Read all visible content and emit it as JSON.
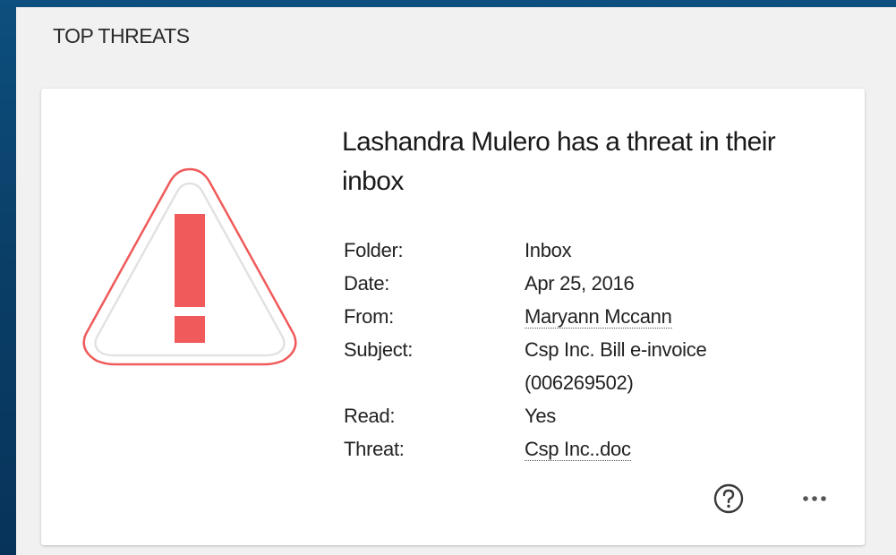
{
  "panel": {
    "title": "TOP THREATS"
  },
  "threat_card": {
    "heading": "Lashandra Mulero has a threat in their inbox",
    "icon": "warning-triangle-icon",
    "fields": [
      {
        "label": "Folder:",
        "value": "Inbox"
      },
      {
        "label": "Date:",
        "value": "Apr 25, 2016"
      },
      {
        "label": "From:",
        "value": "Maryann Mccann"
      },
      {
        "label": "Subject:",
        "value": "Csp Inc. Bill e-invoice (006269502)"
      },
      {
        "label": "Read:",
        "value": "Yes"
      },
      {
        "label": "Threat:",
        "value": "Csp Inc..doc"
      }
    ],
    "actions": {
      "help_icon": "question-circle-icon",
      "more_icon": "ellipsis-icon"
    }
  },
  "colors": {
    "background": "#0a3f68",
    "panel": "#f1f1f1",
    "card": "#ffffff",
    "warning_red": "#f05a5a"
  }
}
